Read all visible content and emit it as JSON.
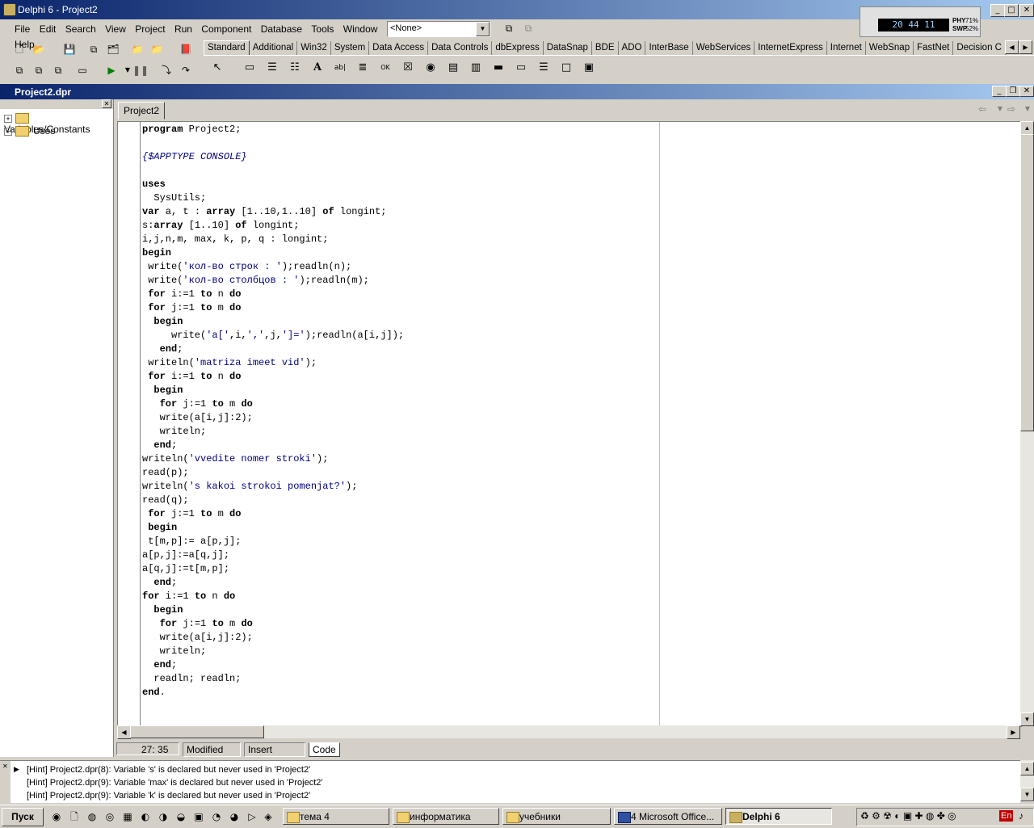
{
  "window": {
    "title": "Delphi 6 - Project2"
  },
  "menu": [
    "File",
    "Edit",
    "Search",
    "View",
    "Project",
    "Run",
    "Component",
    "Database",
    "Tools",
    "Window",
    "Help"
  ],
  "combo": {
    "value": "<None>"
  },
  "palette_tabs": [
    "Standard",
    "Additional",
    "Win32",
    "System",
    "Data Access",
    "Data Controls",
    "dbExpress",
    "DataSnap",
    "BDE",
    "ADO",
    "InterBase",
    "WebServices",
    "InternetExpress",
    "Internet",
    "WebSnap",
    "FastNet",
    "Decision C"
  ],
  "widget": {
    "time": "20 44 11",
    "phy": "PHY",
    "swp": "SWP",
    "phy_val": "71%",
    "swp_val": "52%"
  },
  "editor": {
    "title": "Project2.dpr",
    "tab": "Project2",
    "explorer": [
      "Variables/Constants",
      "Uses"
    ],
    "code": [
      "program Project2;",
      "",
      "{$APPTYPE CONSOLE}",
      "",
      "uses",
      "  SysUtils;",
      "var a, t : array [1..10,1..10] of longint;",
      "s:array [1..10] of longint;",
      "i,j,n,m, max, k, p, q : longint;",
      "begin",
      " write('кол-во строк : ');readln(n);",
      " write('кол-во столбцов : ');readln(m);",
      " for i:=1 to n do",
      " for j:=1 to m do",
      "  begin",
      "     write('a[',i,',',j,']=');readln(a[i,j]);",
      "   end;",
      " writeln('matriza imeet vid');",
      " for i:=1 to n do",
      "  begin",
      "   for j:=1 to m do",
      "   write(a[i,j]:2);",
      "   writeln;",
      "  end;",
      "writeln('vvedite nomer stroki');",
      "read(p);",
      "writeln('s kakoi strokoi pomenjat?');",
      "read(q);",
      " for j:=1 to m do",
      " begin",
      " t[m,p]:= a[p,j];",
      "a[p,j]:=a[q,j];",
      "a[q,j]:=t[m,p];",
      "  end;",
      "for i:=1 to n do",
      "  begin",
      "   for j:=1 to m do",
      "   write(a[i,j]:2);",
      "   writeln;",
      "  end;",
      "  readln; readln;",
      "end."
    ]
  },
  "status": {
    "position": "27: 35",
    "modified": "Modified",
    "mode": "Insert",
    "view_tab": "Code"
  },
  "messages": [
    "[Hint] Project2.dpr(8): Variable 's' is declared but never used in 'Project2'",
    "[Hint] Project2.dpr(9): Variable 'max' is declared but never used in 'Project2'",
    "[Hint] Project2.dpr(9): Variable 'k' is declared but never used in 'Project2'"
  ],
  "taskbar": {
    "start": "Пуск",
    "tasks": [
      "тема 4",
      "информатика",
      "учебники",
      "4 Microsoft Office...",
      "Delphi 6"
    ],
    "lang": "En"
  }
}
